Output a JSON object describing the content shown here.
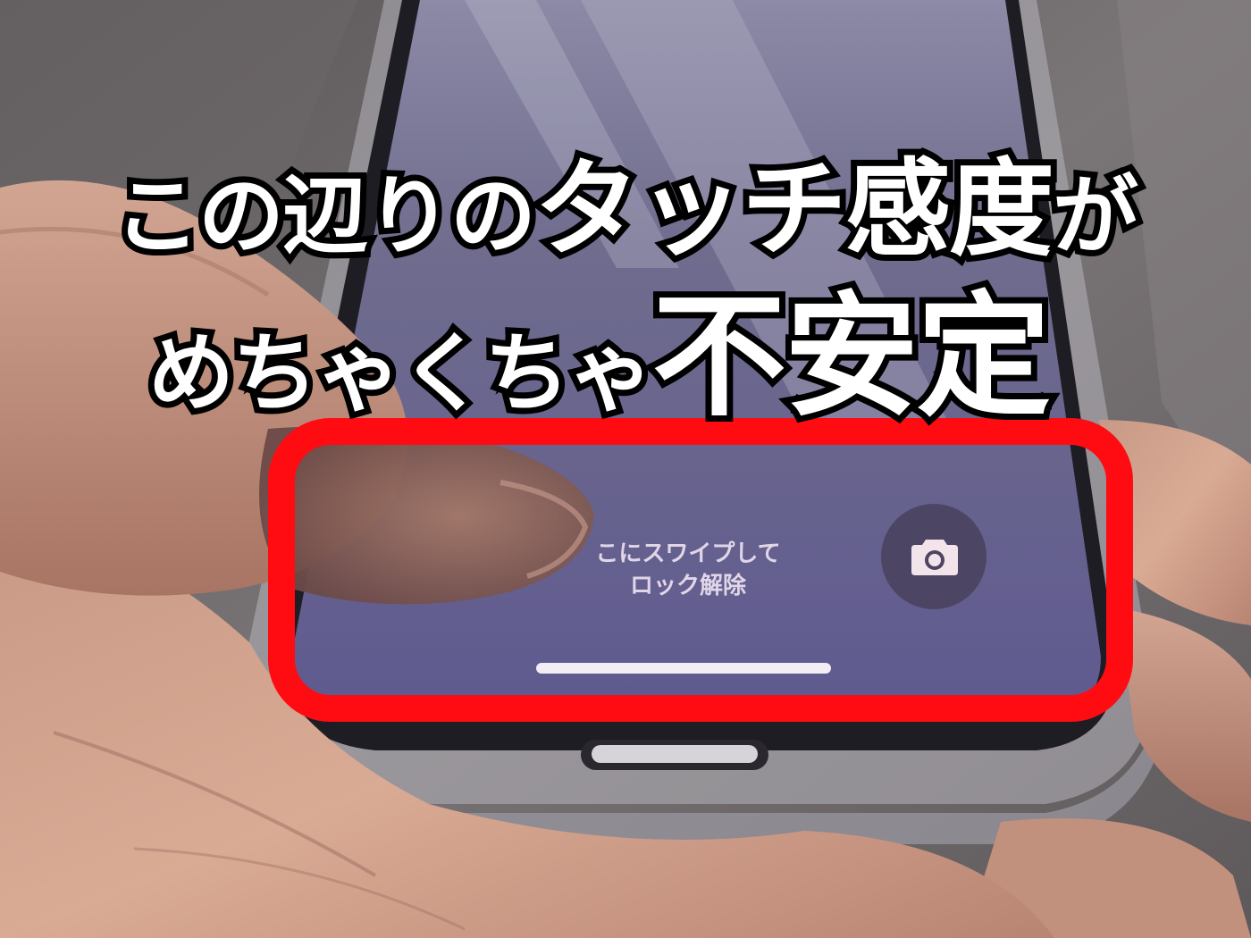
{
  "caption": {
    "line1_part1": "この辺りの",
    "line1_part2": "タッチ感度",
    "line1_part3": "が",
    "line2_part1": "めちゃくちゃ",
    "line2_part2": "不安定"
  },
  "lock_screen": {
    "hint_line1": "こにスワイプして",
    "hint_line2": "ロック解除",
    "camera_icon": "camera-icon"
  },
  "colors": {
    "highlight": "#ff0b12",
    "screen": "#6d6796",
    "caption_fill": "#ffffff",
    "caption_stroke": "#000000"
  }
}
